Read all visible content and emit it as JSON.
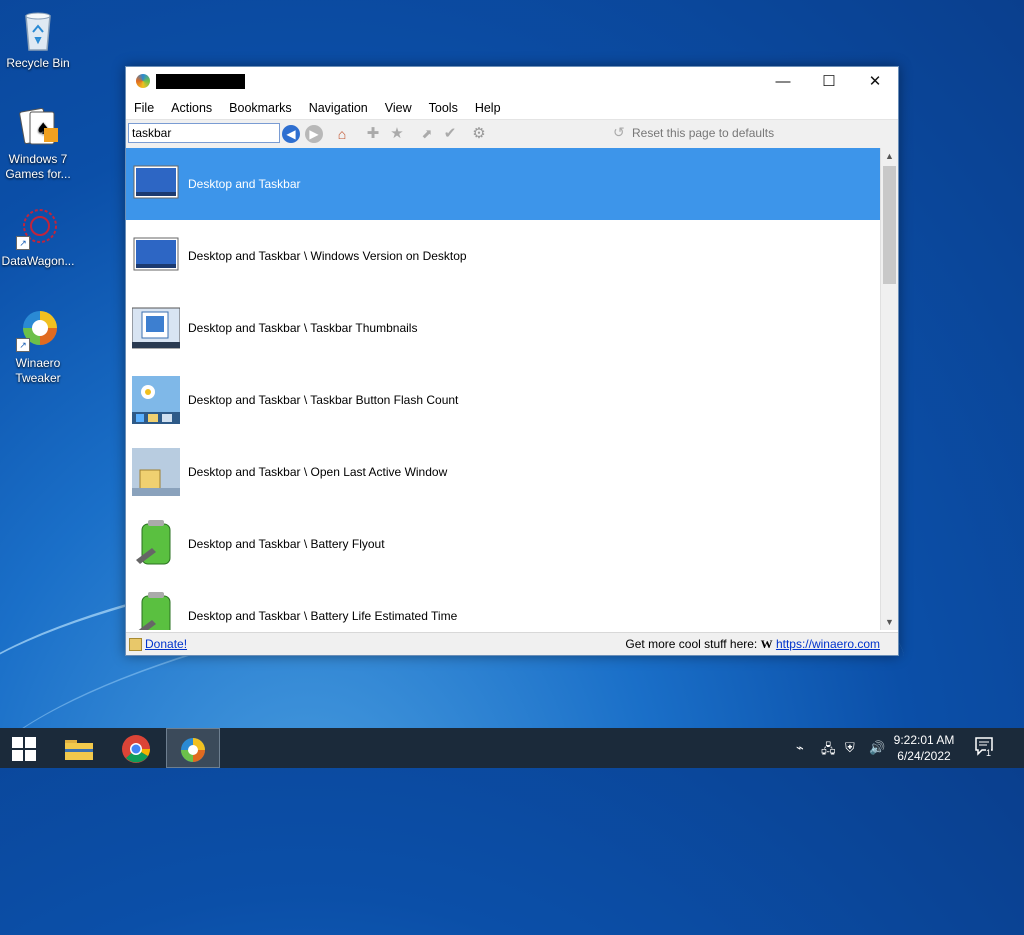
{
  "desktop": {
    "icons": [
      {
        "label": "Recycle Bin"
      },
      {
        "label": "Windows 7 Games for..."
      },
      {
        "label": "DataWagon..."
      },
      {
        "label": "Winaero Tweaker"
      }
    ]
  },
  "window": {
    "controls": {
      "minimize": "—",
      "maximize": "☐",
      "close": "✕"
    },
    "menu": [
      "File",
      "Actions",
      "Bookmarks",
      "Navigation",
      "View",
      "Tools",
      "Help"
    ],
    "search": {
      "value": "taskbar"
    },
    "reset_label": "Reset this page to defaults",
    "results": [
      {
        "label": "Desktop and Taskbar",
        "selected": true
      },
      {
        "label": "Desktop and Taskbar \\ Windows Version on Desktop"
      },
      {
        "label": "Desktop and Taskbar \\ Taskbar Thumbnails"
      },
      {
        "label": "Desktop and Taskbar \\ Taskbar Button Flash Count"
      },
      {
        "label": "Desktop and Taskbar \\ Open Last Active Window"
      },
      {
        "label": "Desktop and Taskbar \\ Battery Flyout"
      },
      {
        "label": "Desktop and Taskbar \\ Battery Life Estimated Time"
      }
    ],
    "status": {
      "donate": "Donate!",
      "cool_text": "Get more cool stuff here:",
      "logo": "W",
      "link": "https://winaero.com"
    }
  },
  "taskbar": {
    "time": "9:22:01 AM",
    "date": "6/24/2022",
    "notification_count": "1"
  },
  "colors": {
    "selection": "#3d95ea",
    "taskbar": "#1b2a3a",
    "link": "#0033cc"
  }
}
